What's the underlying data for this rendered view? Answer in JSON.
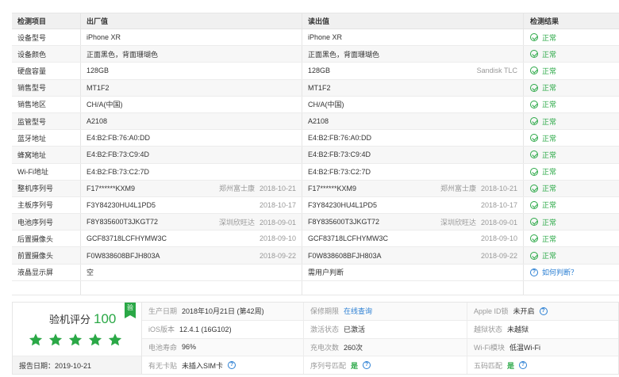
{
  "table": {
    "headers": [
      "检测项目",
      "出厂值",
      "读出值",
      "检测结果"
    ],
    "rows": [
      {
        "item": "设备型号",
        "factory": "iPhone XR",
        "factory_note": "",
        "factory_date": "",
        "read": "iPhone XR",
        "read_note": "",
        "read_date": "",
        "result": "正常"
      },
      {
        "item": "设备颜色",
        "factory": "正面黑色，背面珊瑚色",
        "factory_note": "",
        "factory_date": "",
        "read": "正面黑色，背面珊瑚色",
        "read_note": "",
        "read_date": "",
        "result": "正常"
      },
      {
        "item": "硬盘容量",
        "factory": "128GB",
        "factory_note": "",
        "factory_date": "",
        "read": "128GB",
        "read_note": "Sandisk TLC",
        "read_date": "",
        "result": "正常"
      },
      {
        "item": "销售型号",
        "factory": "MT1F2",
        "factory_note": "",
        "factory_date": "",
        "read": "MT1F2",
        "read_note": "",
        "read_date": "",
        "result": "正常"
      },
      {
        "item": "销售地区",
        "factory": "CH/A(中国)",
        "factory_note": "",
        "factory_date": "",
        "read": "CH/A(中国)",
        "read_note": "",
        "read_date": "",
        "result": "正常"
      },
      {
        "item": "监管型号",
        "factory": "A2108",
        "factory_note": "",
        "factory_date": "",
        "read": "A2108",
        "read_note": "",
        "read_date": "",
        "result": "正常"
      },
      {
        "item": "蓝牙地址",
        "factory": "E4:B2:FB:76:A0:DD",
        "factory_note": "",
        "factory_date": "",
        "read": "E4:B2:FB:76:A0:DD",
        "read_note": "",
        "read_date": "",
        "result": "正常"
      },
      {
        "item": "蜂窝地址",
        "factory": "E4:B2:FB:73:C9:4D",
        "factory_note": "",
        "factory_date": "",
        "read": "E4:B2:FB:73:C9:4D",
        "read_note": "",
        "read_date": "",
        "result": "正常"
      },
      {
        "item": "Wi-Fi地址",
        "factory": "E4:B2:FB:73:C2:7D",
        "factory_note": "",
        "factory_date": "",
        "read": "E4:B2:FB:73:C2:7D",
        "read_note": "",
        "read_date": "",
        "result": "正常"
      },
      {
        "item": "整机序列号",
        "factory": "F17******KXM9",
        "factory_note": "郑州富士康",
        "factory_date": "2018-10-21",
        "read": "F17******KXM9",
        "read_note": "郑州富士康",
        "read_date": "2018-10-21",
        "result": "正常"
      },
      {
        "item": "主板序列号",
        "factory": "F3Y84230HU4L1PD5",
        "factory_note": "",
        "factory_date": "2018-10-17",
        "read": "F3Y84230HU4L1PD5",
        "read_note": "",
        "read_date": "2018-10-17",
        "result": "正常"
      },
      {
        "item": "电池序列号",
        "factory": "F8Y835600T3JKGT72",
        "factory_note": "深圳欣旺达",
        "factory_date": "2018-09-01",
        "read": "F8Y835600T3JKGT72",
        "read_note": "深圳欣旺达",
        "read_date": "2018-09-01",
        "result": "正常"
      },
      {
        "item": "后置摄像头",
        "factory": "GCF83718LCFHYMW3C",
        "factory_note": "",
        "factory_date": "2018-09-10",
        "read": "GCF83718LCFHYMW3C",
        "read_note": "",
        "read_date": "2018-09-10",
        "result": "正常"
      },
      {
        "item": "前置摄像头",
        "factory": "F0W838608BFJH803A",
        "factory_note": "",
        "factory_date": "2018-09-22",
        "read": "F0W838608BFJH803A",
        "read_note": "",
        "read_date": "2018-09-22",
        "result": "正常"
      },
      {
        "item": "液晶显示屏",
        "factory": "空",
        "factory_note": "",
        "factory_date": "",
        "read": "需用户判断",
        "read_note": "",
        "read_date": "",
        "result": "如何判断？",
        "result_type": "ask"
      }
    ]
  },
  "summary": {
    "badge": "验",
    "score_label": "验机评分",
    "score": "100",
    "stars": 5,
    "report_date": "报告日期：2019-10-21",
    "grid": [
      [
        {
          "label": "生产日期",
          "value": "2018年10月21日 (第42周)",
          "style": ""
        },
        {
          "label": "保修期限",
          "value": "在线查询",
          "style": "link"
        },
        {
          "label": "Apple ID锁",
          "value": "未开启",
          "style": "",
          "help": true
        }
      ],
      [
        {
          "label": "iOS版本",
          "value": "12.4.1 (16G102)",
          "style": ""
        },
        {
          "label": "激活状态",
          "value": "已激活",
          "style": ""
        },
        {
          "label": "越狱状态",
          "value": "未越狱",
          "style": ""
        }
      ],
      [
        {
          "label": "电池寿命",
          "value": "96%",
          "style": ""
        },
        {
          "label": "充电次数",
          "value": "260次",
          "style": ""
        },
        {
          "label": "Wi-Fi模块",
          "value": "低温Wi-Fi",
          "style": ""
        }
      ],
      [
        {
          "label": "有无卡贴",
          "value": "未插入SIM卡",
          "style": "",
          "help": true
        },
        {
          "label": "序列号匹配",
          "value": "是",
          "style": "green",
          "help": true
        },
        {
          "label": "五码匹配",
          "value": "是",
          "style": "green",
          "help": true
        }
      ]
    ]
  },
  "colors": {
    "ok": "#2aa846",
    "link": "#2b7fd3",
    "header_bg": "#f0f0f0"
  },
  "icons": {
    "ok": "check-circle-icon",
    "help": "question-circle-icon",
    "star": "star-icon"
  }
}
